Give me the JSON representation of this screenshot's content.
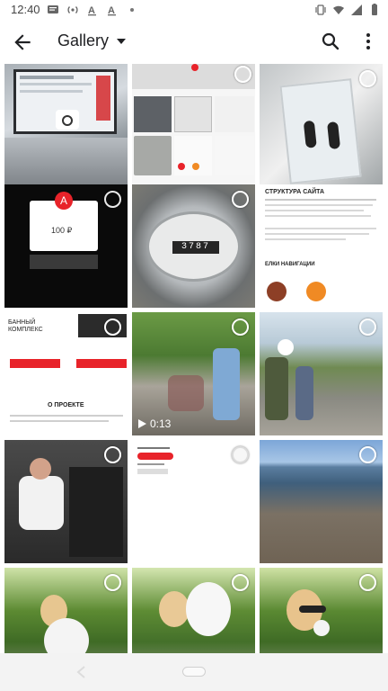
{
  "status_bar": {
    "time": "12:40"
  },
  "app_bar": {
    "title": "Gallery",
    "back_icon": "arrow-back-icon",
    "dropdown_icon": "caret-down-icon",
    "search_icon": "search-icon",
    "more_icon": "more-vert-icon"
  },
  "tiles": [
    {
      "name": "photo-laptop-screen",
      "kind": "photo"
    },
    {
      "name": "screenshot-multiple-images",
      "kind": "screenshot"
    },
    {
      "name": "photo-earphones-package",
      "kind": "photo"
    },
    {
      "name": "screenshot-bank-app",
      "kind": "screenshot"
    },
    {
      "name": "photo-electric-meter",
      "kind": "photo"
    },
    {
      "name": "screenshot-site-structure",
      "kind": "screenshot"
    },
    {
      "name": "screenshot-project-page",
      "kind": "screenshot"
    },
    {
      "name": "video-crowd-street",
      "kind": "video",
      "duration": "0:13"
    },
    {
      "name": "photo-crowd-park",
      "kind": "photo"
    },
    {
      "name": "photo-man-gesturing",
      "kind": "photo"
    },
    {
      "name": "screenshot-blank-list",
      "kind": "screenshot"
    },
    {
      "name": "photo-riverbank",
      "kind": "photo"
    },
    {
      "name": "photo-woman-cotton-candy-1",
      "kind": "photo"
    },
    {
      "name": "photo-woman-cotton-candy-2",
      "kind": "photo"
    },
    {
      "name": "photo-woman-cotton-candy-3",
      "kind": "photo"
    }
  ],
  "tile_texts": {
    "structure_title": "СТРУКТУРА САЙТА",
    "palette_title": "ЕЛКИ НАВИГАЦИИ",
    "project_about": "О ПРОЕКТЕ",
    "banner_word": "БАННЫЙ КОМПЛЕКС",
    "tile_meter_digits": "3787"
  },
  "colors": {
    "accent_red": "#e8232a",
    "appbar_bg": "#ffffff",
    "navbar_bg": "#f3f3f3"
  }
}
